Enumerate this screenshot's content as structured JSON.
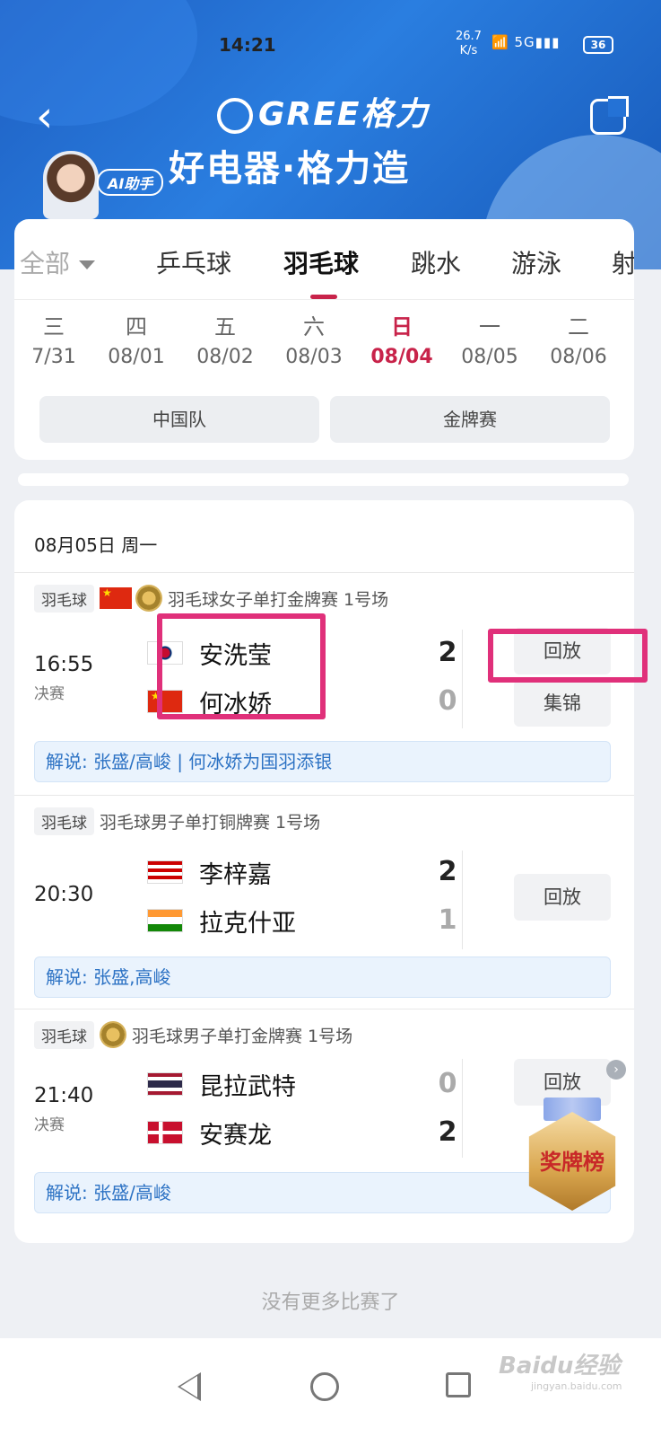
{
  "status_bar": {
    "time": "14:21",
    "net_speed": "26.7",
    "net_unit": "K/s",
    "signal": "5G",
    "battery": "36"
  },
  "header": {
    "brand": "GREE格力",
    "slogan": "好电器·格力造",
    "ai_label": "AI助手"
  },
  "sport_tabs": [
    {
      "label": "全部"
    },
    {
      "label": "乒乓球"
    },
    {
      "label": "羽毛球",
      "active": true
    },
    {
      "label": "跳水"
    },
    {
      "label": "游泳"
    },
    {
      "label": "射"
    }
  ],
  "days": [
    {
      "weekday": "三",
      "date": "7/31"
    },
    {
      "weekday": "四",
      "date": "08/01"
    },
    {
      "weekday": "五",
      "date": "08/02"
    },
    {
      "weekday": "六",
      "date": "08/03"
    },
    {
      "weekday": "日",
      "date": "08/04",
      "active": true
    },
    {
      "weekday": "一",
      "date": "08/05"
    },
    {
      "weekday": "二",
      "date": "08/06"
    }
  ],
  "filters": [
    "中国队",
    "金牌赛"
  ],
  "schedule": {
    "day_heading": "08月05日 周一",
    "matches": [
      {
        "sport": "羽毛球",
        "event": "羽毛球女子单打金牌赛 1号场",
        "time": "16:55",
        "stage": "决赛",
        "players": [
          {
            "name": "安洗莹",
            "score": "2"
          },
          {
            "name": "何冰娇",
            "score": "0"
          }
        ],
        "buttons": [
          "回放",
          "集锦"
        ],
        "commentary": "解说: 张盛/高峻 | 何冰娇为国羽添银"
      },
      {
        "sport": "羽毛球",
        "event": "羽毛球男子单打铜牌赛 1号场",
        "time": "20:30",
        "stage": "",
        "players": [
          {
            "name": "李梓嘉",
            "score": "2"
          },
          {
            "name": "拉克什亚",
            "score": "1"
          }
        ],
        "buttons": [
          "回放"
        ],
        "commentary": "解说: 张盛,高峻"
      },
      {
        "sport": "羽毛球",
        "event": "羽毛球男子单打金牌赛 1号场",
        "time": "21:40",
        "stage": "决赛",
        "players": [
          {
            "name": "昆拉武特",
            "score": "0"
          },
          {
            "name": "安赛龙",
            "score": "2"
          }
        ],
        "buttons": [
          "回放"
        ],
        "commentary": "解说: 张盛/高峻"
      }
    ]
  },
  "medal_badge": "奖牌榜",
  "footer_text": "没有更多比赛了",
  "watermark": "Baidu经验",
  "watermark_sub": "jingyan.baidu.com",
  "colors": {
    "accent": "#c8234a",
    "header_blue": "#2472d6",
    "highlight": "#e0307a",
    "commentary_text": "#2c72c4"
  }
}
